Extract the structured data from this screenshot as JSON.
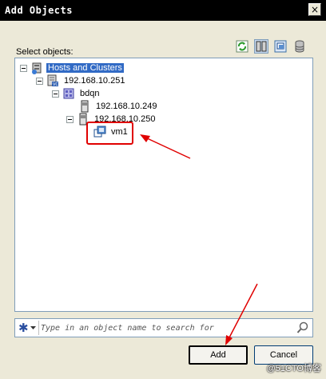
{
  "window": {
    "title": "Add Objects",
    "close_glyph": "×"
  },
  "toolbar": {
    "icons": [
      "refresh-icon",
      "hosts-view-icon",
      "vms-view-icon",
      "datastores-view-icon"
    ]
  },
  "select_label": "Select objects:",
  "tree": {
    "root": "Hosts and Clusters",
    "vcenter": "192.168.10.251",
    "datacenter": "bdqn",
    "host1": "192.168.10.249",
    "host2": "192.168.10.250",
    "vm": "vm1"
  },
  "search": {
    "filter_glyph": "✱",
    "placeholder": "Type in an object name to search for"
  },
  "buttons": {
    "add": "Add",
    "cancel": "Cancel"
  },
  "watermark": "@51CTO博客",
  "colors": {
    "title_bg": "#000000",
    "selection": "#316ac5",
    "annotation": "#e00000"
  }
}
